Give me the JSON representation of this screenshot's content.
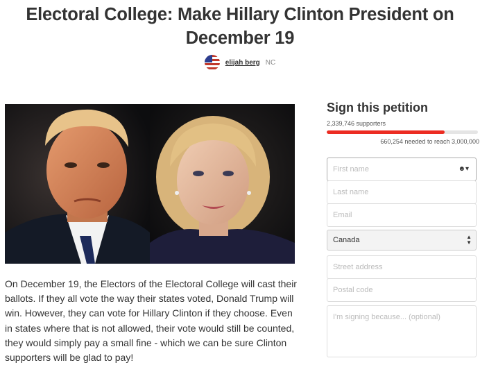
{
  "title": "Electoral College: Make Hillary Clinton President on December 19",
  "author": {
    "name": "elijah berg",
    "location": "NC"
  },
  "description": "On December 19, the Electors of the Electoral College will cast their ballots. If they all vote the way their states voted, Donald Trump will win. However, they can vote for Hillary Clinton if they choose. Even in states where that is not allowed, their vote would still be counted, they would simply pay a small fine - which we can be sure Clinton supporters will be glad to pay!",
  "petition": {
    "heading": "Sign this petition",
    "supporters": "2,339,746 supporters",
    "needed": "660,254 needed to reach 3,000,000",
    "progress_fraction": 0.78,
    "fields": {
      "first_name": "First name",
      "last_name": "Last name",
      "email": "Email",
      "country": "Canada",
      "street": "Street address",
      "postal": "Postal code",
      "reason": "I'm signing because... (optional)"
    }
  },
  "colors": {
    "accent": "#ec2c22",
    "text": "#333333"
  }
}
